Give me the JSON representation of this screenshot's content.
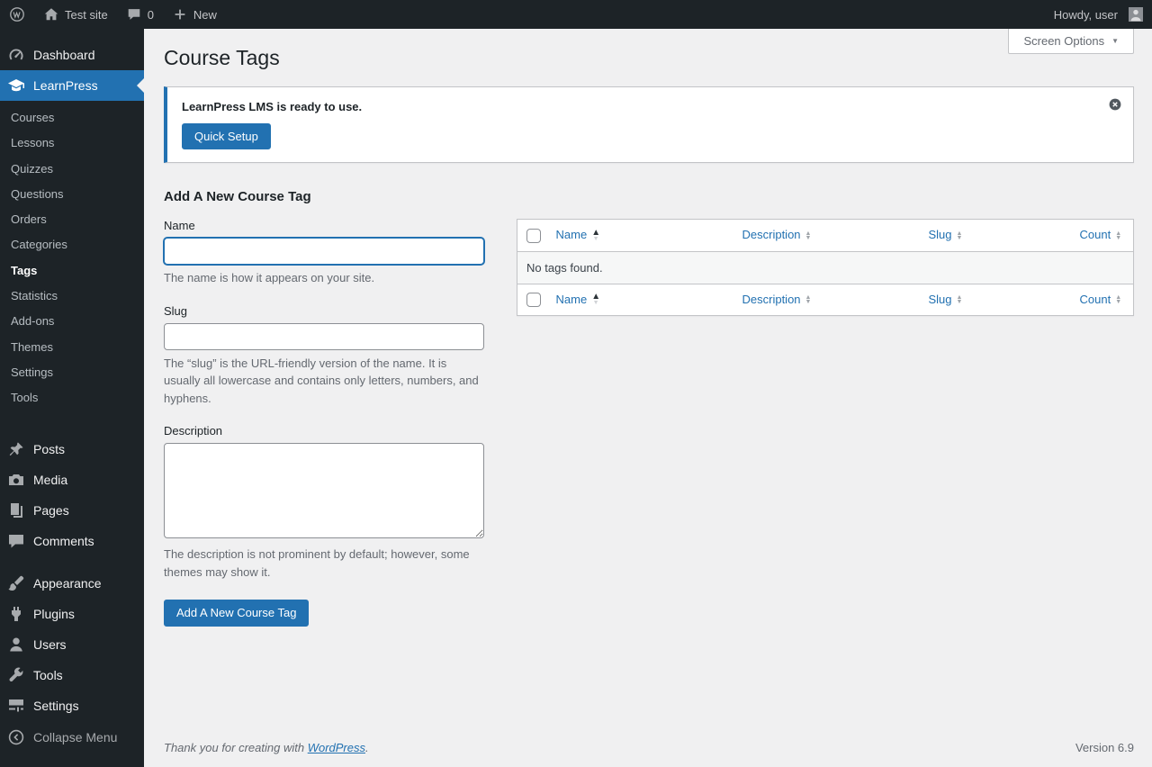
{
  "admin_bar": {
    "site_name": "Test site",
    "comments_count": "0",
    "new_label": "New",
    "howdy_text": "Howdy, user"
  },
  "sidebar": {
    "dashboard_label": "Dashboard",
    "learnpress_label": "LearnPress",
    "submenu": [
      "Courses",
      "Lessons",
      "Quizzes",
      "Questions",
      "Orders",
      "Categories",
      "Tags",
      "Statistics",
      "Add-ons",
      "Themes",
      "Settings",
      "Tools"
    ],
    "group2": [
      "Posts",
      "Media",
      "Pages",
      "Comments"
    ],
    "group3": [
      "Appearance",
      "Plugins",
      "Users",
      "Tools",
      "Settings"
    ],
    "collapse_label": "Collapse Menu"
  },
  "main": {
    "page_title": "Course Tags",
    "screen_options_label": "Screen Options",
    "notice": {
      "message": "LearnPress LMS is ready to use.",
      "quick_setup_label": "Quick Setup"
    },
    "add_form": {
      "heading": "Add A New Course Tag",
      "name_label": "Name",
      "name_value": "",
      "name_help": "The name is how it appears on your site.",
      "slug_label": "Slug",
      "slug_value": "",
      "slug_help": "The “slug” is the URL-friendly version of the name. It is usually all lowercase and contains only letters, numbers, and hyphens.",
      "description_label": "Description",
      "description_value": "",
      "description_help": "The description is not prominent by default; however, some themes may show it.",
      "submit_label": "Add A New Course Tag"
    },
    "table": {
      "columns": [
        "Name",
        "Description",
        "Slug",
        "Count"
      ],
      "empty_message": "No tags found."
    }
  },
  "footer": {
    "thanks_text": "Thank you for creating with ",
    "wordpress_link_label": "WordPress",
    "period": ".",
    "version_text": "Version 6.9"
  },
  "icons": {
    "sort_up": "▲",
    "sort_down": "▼",
    "screen_options_arrow": "▼"
  },
  "colors": {
    "accent": "#2271b1",
    "admin_dark": "#1d2327",
    "content_bg": "#f0f0f1"
  }
}
